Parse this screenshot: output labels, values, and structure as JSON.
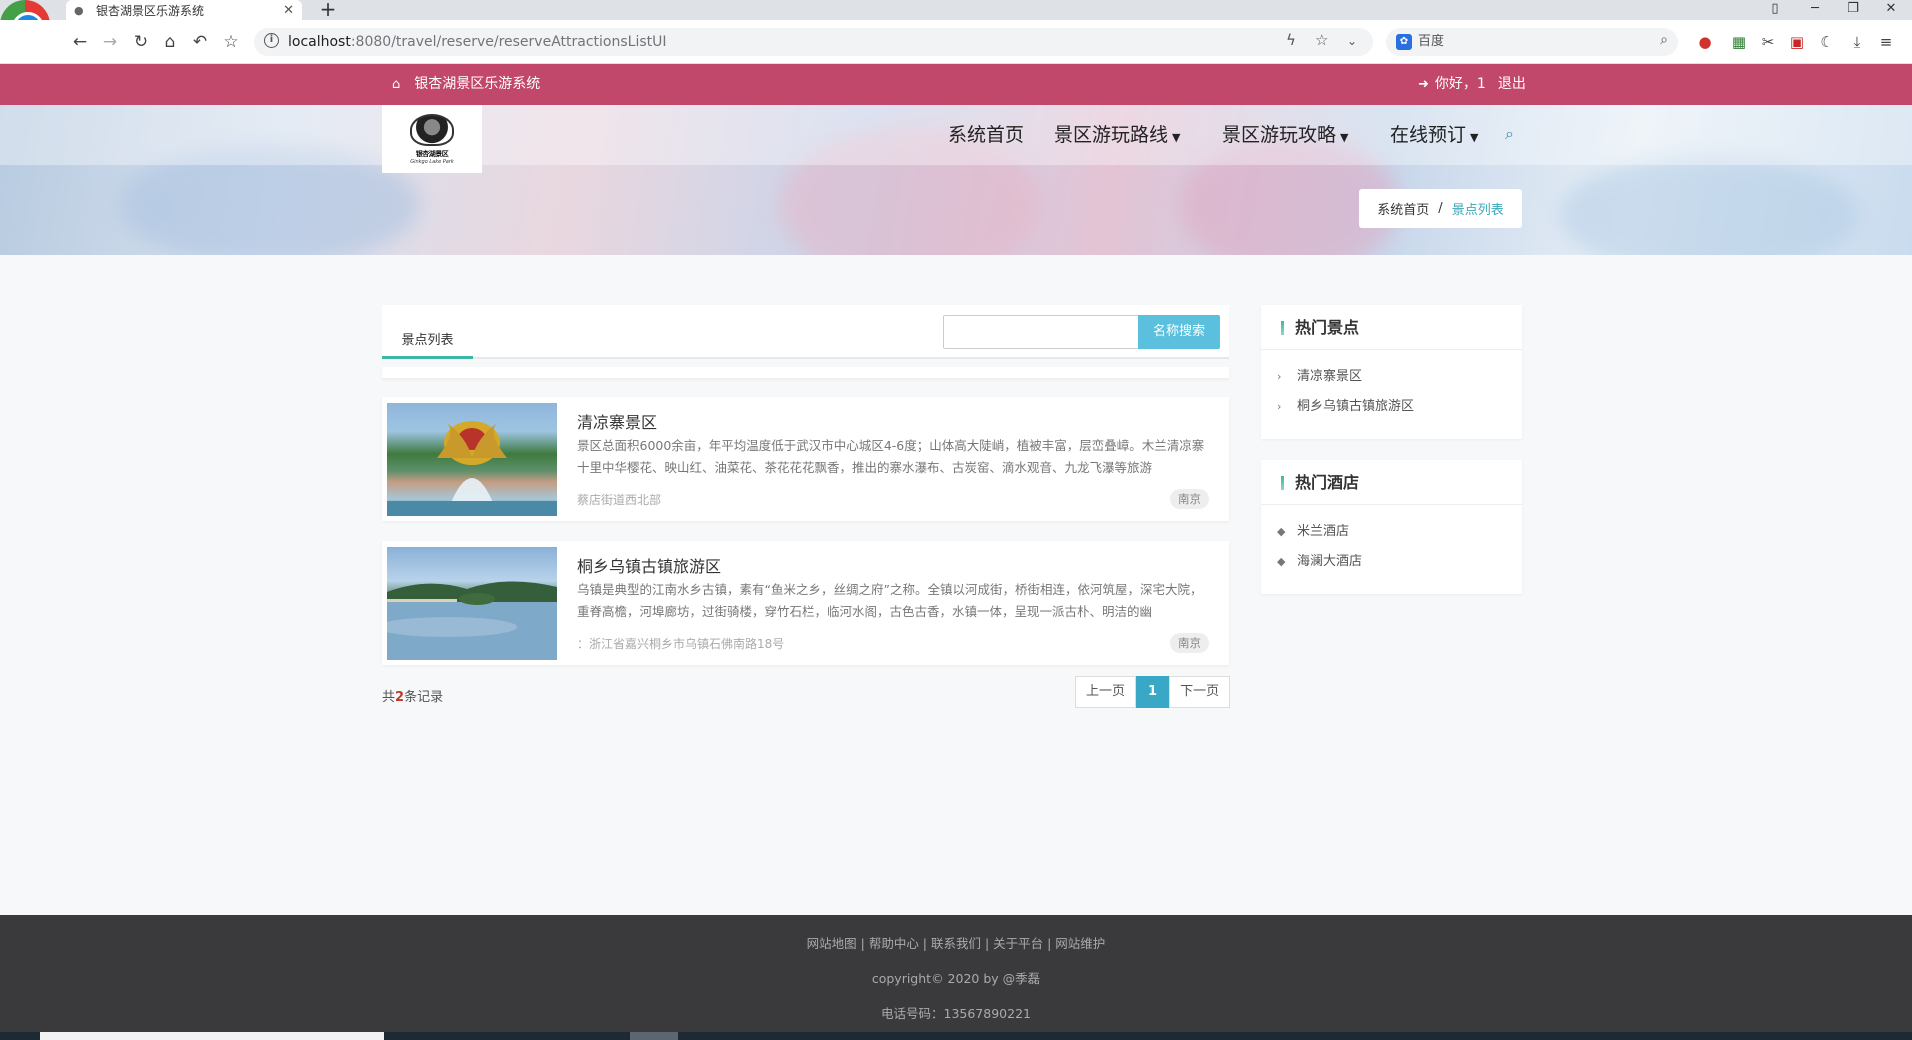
{
  "browser": {
    "tab_title": "银杏湖景区乐游系统",
    "url_host": "localhost",
    "url_rest": ":8080/travel/reserve/reserveAttractionsListUI",
    "search_placeholder": "百度",
    "search_engine_icon": "baidu-paw-icon"
  },
  "site": {
    "brand": "银杏湖景区乐游系统",
    "greeting": "你好，1",
    "logout": "退出",
    "logo_text": "银杏湖景区",
    "logo_sub": "Ginkgo Lake Park"
  },
  "nav": {
    "home": "系统首页",
    "routes": "景区游玩路线",
    "guides": "景区游玩攻略",
    "booking": "在线预订"
  },
  "breadcrumb": {
    "home": "系统首页",
    "current": "景点列表"
  },
  "list": {
    "tab": "景点列表",
    "search_button": "名称搜索",
    "search_value": "",
    "items": [
      {
        "title": "清凉寨景区",
        "desc": "景区总面积6000余亩，年平均温度低于武汉市中心城区4-6度；山体高大陡峭，植被丰富，层峦叠嶂。木兰清凉寨十里中华樱花、映山红、油菜花、茶花花花飘香，推出的寨水瀑布、古炭窑、滴水观音、九龙飞瀑等旅游",
        "address": "蔡店街道西北部",
        "city": "南京"
      },
      {
        "title": "桐乡乌镇古镇旅游区",
        "desc": "乌镇是典型的江南水乡古镇，素有“鱼米之乡，丝绸之府”之称。全镇以河成街，桥街相连，依河筑屋，深宅大院，重脊高檐，河埠廊坊，过街骑楼，穿竹石栏，临河水阁，古色古香，水镇一体，呈现一派古朴、明洁的幽",
        "address": "：浙江省嘉兴桐乡市乌镇石佛南路18号",
        "city": "南京"
      }
    ],
    "total_prefix": "共",
    "total_count": "2",
    "total_suffix": "条记录",
    "pager": {
      "prev": "上一页",
      "current": "1",
      "next": "下一页"
    }
  },
  "sidebar": {
    "attractions_title": "热门景点",
    "attractions": [
      "清凉寨景区",
      "桐乡乌镇古镇旅游区"
    ],
    "hotels_title": "热门酒店",
    "hotels": [
      "米兰酒店",
      "海澜大酒店"
    ]
  },
  "footer": {
    "links": "网站地图 | 帮助中心 | 联系我们 | 关于平台 | 网站维护",
    "copyright": "copyright© 2020 by @季磊",
    "phone": "电话号码：13567890221"
  },
  "colors": {
    "topbar": "#c1486a",
    "accent": "#39a8b8",
    "search_button": "#5bc0de",
    "footer": "#3a3a3c"
  }
}
